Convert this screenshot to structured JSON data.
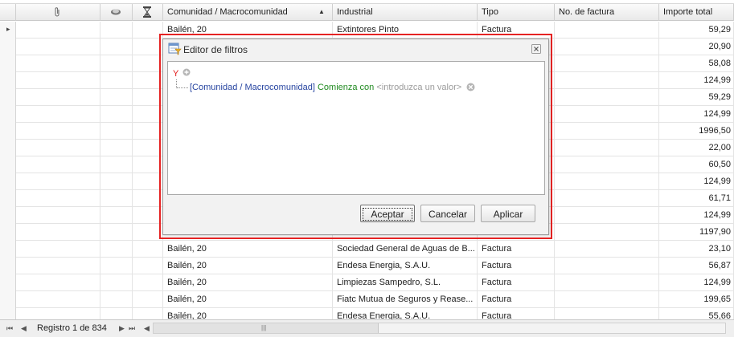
{
  "columns": {
    "attach_icon": "paperclip-icon",
    "second_icon": "disc-icon",
    "third_icon": "hourglass-icon",
    "comunidad": "Comunidad / Macrocomunidad",
    "industrial": "Industrial",
    "tipo": "Tipo",
    "factura": "No. de factura",
    "importe": "Importe total",
    "sort_indicator": "▲"
  },
  "rows": [
    {
      "comunidad": "Bailén, 20",
      "industrial": "Extintores Pinto",
      "tipo": "Factura",
      "factura": "",
      "importe": "59,29"
    },
    {
      "comunidad": "",
      "industrial": "",
      "tipo": "",
      "factura": "",
      "importe": "20,90"
    },
    {
      "comunidad": "",
      "industrial": "",
      "tipo": "",
      "factura": "",
      "importe": "58,08"
    },
    {
      "comunidad": "",
      "industrial": "",
      "tipo": "",
      "factura": "",
      "importe": "124,99"
    },
    {
      "comunidad": "",
      "industrial": "",
      "tipo": "",
      "factura": "",
      "importe": "59,29"
    },
    {
      "comunidad": "",
      "industrial": "",
      "tipo": "",
      "factura": "",
      "importe": "124,99"
    },
    {
      "comunidad": "",
      "industrial": "",
      "tipo": "",
      "factura": "",
      "importe": "1996,50"
    },
    {
      "comunidad": "",
      "industrial": "",
      "tipo": "",
      "factura": "",
      "importe": "22,00"
    },
    {
      "comunidad": "",
      "industrial": "",
      "tipo": "",
      "factura": "",
      "importe": "60,50"
    },
    {
      "comunidad": "",
      "industrial": "",
      "tipo": "",
      "factura": "",
      "importe": "124,99"
    },
    {
      "comunidad": "",
      "industrial": "",
      "tipo": "",
      "factura": "",
      "importe": "61,71"
    },
    {
      "comunidad": "",
      "industrial": "",
      "tipo": "",
      "factura": "",
      "importe": "124,99"
    },
    {
      "comunidad": "",
      "industrial": "",
      "tipo": "",
      "factura": "",
      "importe": "1197,90"
    },
    {
      "comunidad": "Bailén, 20",
      "industrial": "Sociedad General de Aguas de B...",
      "tipo": "Factura",
      "factura": "",
      "importe": "23,10"
    },
    {
      "comunidad": "Bailén, 20",
      "industrial": "Endesa Energia, S.A.U.",
      "tipo": "Factura",
      "factura": "",
      "importe": "56,87"
    },
    {
      "comunidad": "Bailén, 20",
      "industrial": "Limpiezas Sampedro, S.L.",
      "tipo": "Factura",
      "factura": "",
      "importe": "124,99"
    },
    {
      "comunidad": "Bailén, 20",
      "industrial": "Fiatc Mutua de Seguros y Rease...",
      "tipo": "Factura",
      "factura": "",
      "importe": "199,65"
    },
    {
      "comunidad": "Bailén, 20",
      "industrial": "Endesa Energia, S.A.U.",
      "tipo": "Factura",
      "factura": "",
      "importe": "55,66"
    }
  ],
  "row_indicator": "▸",
  "status": {
    "first": "⏮",
    "prev": "◀",
    "record": "Registro 1 de 834",
    "next": "▶",
    "last": "⏭",
    "scroll_left": "◀",
    "grip": "|||"
  },
  "dialog": {
    "icon": "filter-editor-icon",
    "title": "Editor de filtros",
    "group_operator": "Y",
    "condition": {
      "field": "[Comunidad / Macrocomunidad]",
      "operator": "Comienza con",
      "value": "<introduzca un valor>"
    },
    "buttons": {
      "accept": "Aceptar",
      "cancel": "Cancelar",
      "apply": "Aplicar"
    }
  },
  "colors": {
    "highlight_frame": "#e52323",
    "field": "#2644a0",
    "operator": "#208a20",
    "group": "#e21d1d"
  }
}
